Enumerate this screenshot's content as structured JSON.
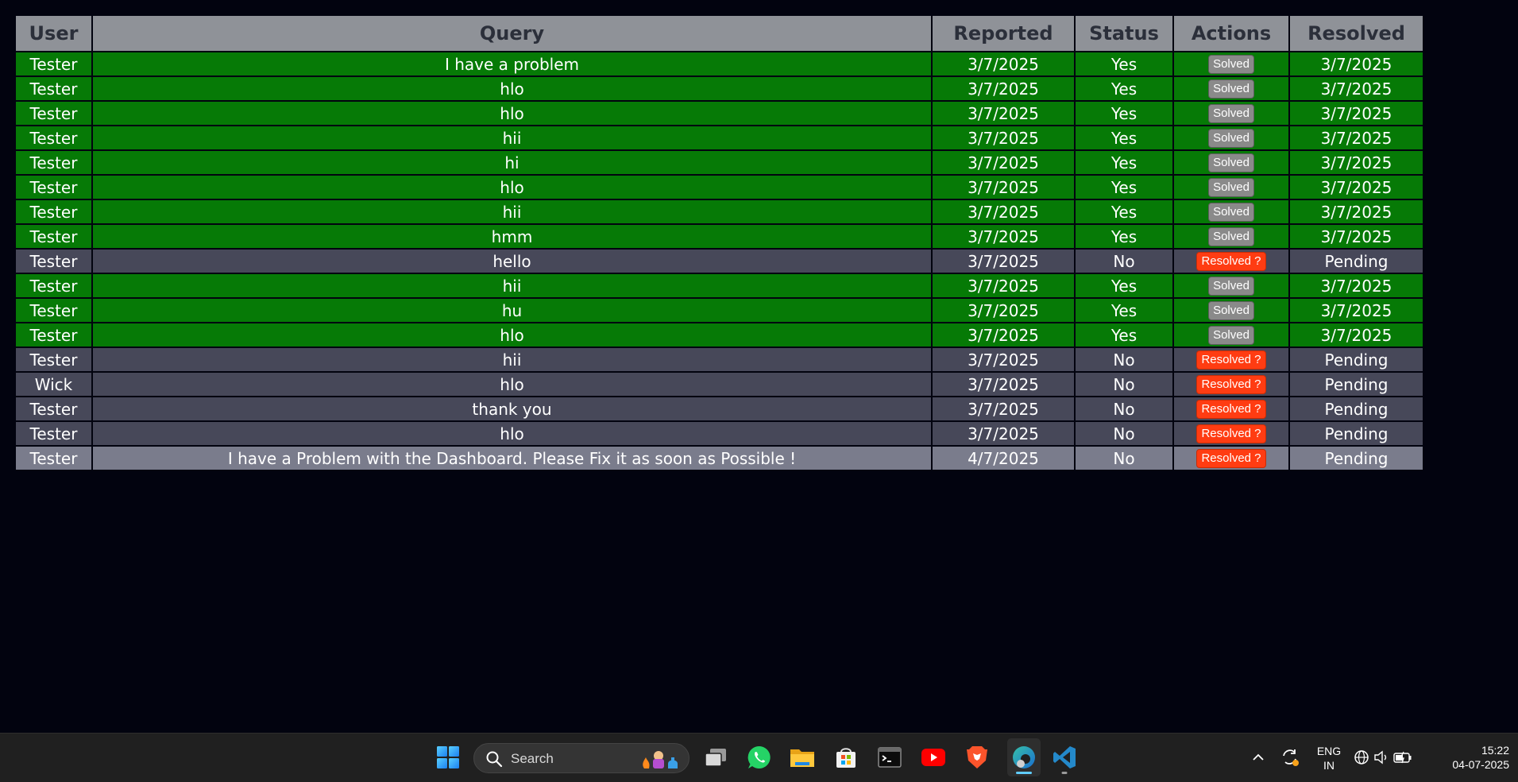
{
  "table": {
    "headers": {
      "user": "User",
      "query": "Query",
      "reported": "Reported",
      "status": "Status",
      "actions": "Actions",
      "resolved": "Resolved"
    },
    "rows": [
      {
        "user": "Tester",
        "query": "I have a problem",
        "reported": "3/7/2025",
        "status": "Yes",
        "action": "Solved",
        "resolved": "3/7/2025"
      },
      {
        "user": "Tester",
        "query": "hlo",
        "reported": "3/7/2025",
        "status": "Yes",
        "action": "Solved",
        "resolved": "3/7/2025"
      },
      {
        "user": "Tester",
        "query": "hlo",
        "reported": "3/7/2025",
        "status": "Yes",
        "action": "Solved",
        "resolved": "3/7/2025"
      },
      {
        "user": "Tester",
        "query": "hii",
        "reported": "3/7/2025",
        "status": "Yes",
        "action": "Solved",
        "resolved": "3/7/2025"
      },
      {
        "user": "Tester",
        "query": "hi",
        "reported": "3/7/2025",
        "status": "Yes",
        "action": "Solved",
        "resolved": "3/7/2025"
      },
      {
        "user": "Tester",
        "query": "hlo",
        "reported": "3/7/2025",
        "status": "Yes",
        "action": "Solved",
        "resolved": "3/7/2025"
      },
      {
        "user": "Tester",
        "query": "hii",
        "reported": "3/7/2025",
        "status": "Yes",
        "action": "Solved",
        "resolved": "3/7/2025"
      },
      {
        "user": "Tester",
        "query": "hmm",
        "reported": "3/7/2025",
        "status": "Yes",
        "action": "Solved",
        "resolved": "3/7/2025"
      },
      {
        "user": "Tester",
        "query": "hello",
        "reported": "3/7/2025",
        "status": "No",
        "action": "Resolved ?",
        "resolved": "Pending"
      },
      {
        "user": "Tester",
        "query": "hii",
        "reported": "3/7/2025",
        "status": "Yes",
        "action": "Solved",
        "resolved": "3/7/2025"
      },
      {
        "user": "Tester",
        "query": "hu",
        "reported": "3/7/2025",
        "status": "Yes",
        "action": "Solved",
        "resolved": "3/7/2025"
      },
      {
        "user": "Tester",
        "query": "hlo",
        "reported": "3/7/2025",
        "status": "Yes",
        "action": "Solved",
        "resolved": "3/7/2025"
      },
      {
        "user": "Tester",
        "query": "hii",
        "reported": "3/7/2025",
        "status": "No",
        "action": "Resolved ?",
        "resolved": "Pending"
      },
      {
        "user": "Wick",
        "query": "hlo",
        "reported": "3/7/2025",
        "status": "No",
        "action": "Resolved ?",
        "resolved": "Pending"
      },
      {
        "user": "Tester",
        "query": "thank you",
        "reported": "3/7/2025",
        "status": "No",
        "action": "Resolved ?",
        "resolved": "Pending"
      },
      {
        "user": "Tester",
        "query": "hlo",
        "reported": "3/7/2025",
        "status": "No",
        "action": "Resolved ?",
        "resolved": "Pending"
      },
      {
        "user": "Tester",
        "query": "I have a Problem with the Dashboard. Please Fix it as soon as Possible !",
        "reported": "4/7/2025",
        "status": "No",
        "action": "Resolved ?",
        "resolved": "Pending"
      }
    ]
  },
  "colors": {
    "solved_row": "#067a06",
    "pending_row": "#474859",
    "highlight_row": "#7a7c8c",
    "header": "#8f9298",
    "resolve_button": "#ff3c12",
    "solved_badge": "#8a8a8a"
  },
  "taskbar": {
    "search_placeholder": "Search",
    "apps": [
      "windows-start-icon",
      "task-view-icon",
      "whatsapp-icon",
      "file-explorer-icon",
      "microsoft-store-icon",
      "terminal-icon",
      "youtube-icon",
      "brave-icon",
      "edge-icon",
      "vscode-icon"
    ],
    "language_line1": "ENG",
    "language_line2": "IN",
    "time": "15:22",
    "date": "04-07-2025"
  }
}
